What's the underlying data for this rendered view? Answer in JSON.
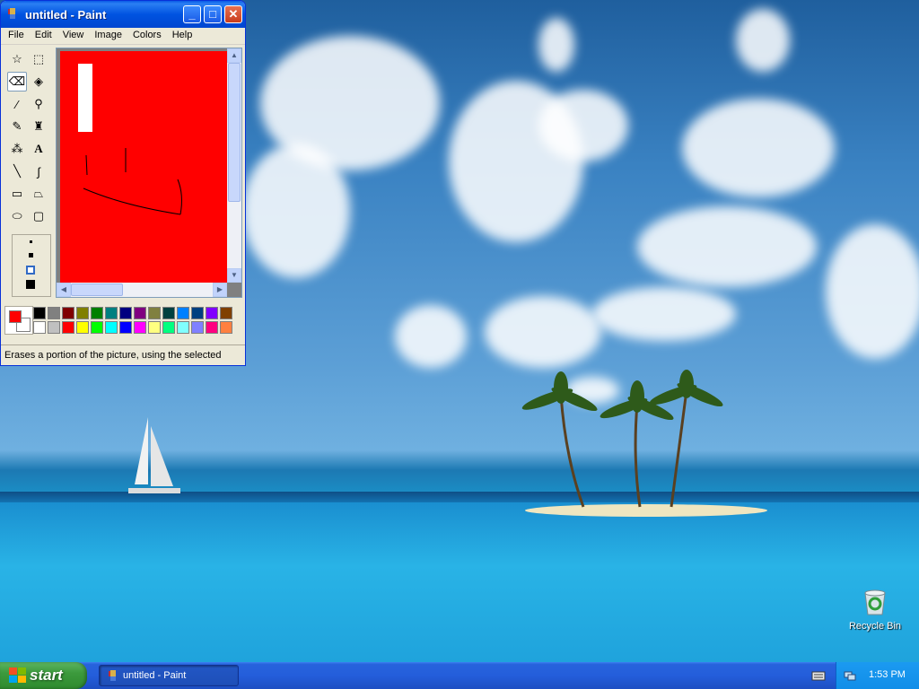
{
  "window": {
    "title": "untitled - Paint",
    "menu": [
      "File",
      "Edit",
      "View",
      "Image",
      "Colors",
      "Help"
    ],
    "status": "Erases a portion of the picture, using the selected",
    "active_tool": "eraser-tool",
    "foreground_color": "#ff0000",
    "background_color": "#ffffff",
    "canvas_color": "#ff0000"
  },
  "tools": [
    "free-form-select-tool",
    "rect-select-tool",
    "eraser-tool",
    "fill-tool",
    "pick-color-tool",
    "magnifier-tool",
    "pencil-tool",
    "brush-tool",
    "airbrush-tool",
    "text-tool",
    "line-tool",
    "curve-tool",
    "rectangle-tool",
    "polygon-tool",
    "ellipse-tool",
    "rounded-rect-tool"
  ],
  "palette": {
    "top": [
      "#000000",
      "#808080",
      "#800000",
      "#808000",
      "#008000",
      "#008080",
      "#000080",
      "#800080",
      "#808040",
      "#004040",
      "#0080ff",
      "#004080",
      "#8000ff",
      "#804000"
    ],
    "bottom": [
      "#ffffff",
      "#c0c0c0",
      "#ff0000",
      "#ffff00",
      "#00ff00",
      "#00ffff",
      "#0000ff",
      "#ff00ff",
      "#ffff80",
      "#00ff80",
      "#80ffff",
      "#8080ff",
      "#ff0080",
      "#ff8040"
    ]
  },
  "desktop": {
    "icons": [
      {
        "label": "Recycle Bin",
        "icon": "recycle-bin-icon"
      }
    ]
  },
  "taskbar": {
    "start_label": "start",
    "task_label": "untitled - Paint",
    "clock": "1:53 PM"
  }
}
